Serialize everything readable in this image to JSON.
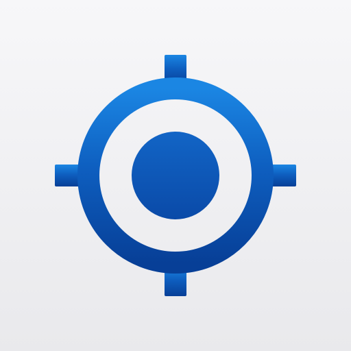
{
  "app_icon": {
    "icon": "crosshair-target-icon",
    "colors": {
      "background_top": "#f7f7f9",
      "background_bottom": "#e9e9ec",
      "accent_light": "#1b86e3",
      "accent_mid": "#0e5fc0",
      "accent_dark": "#073f97"
    }
  }
}
